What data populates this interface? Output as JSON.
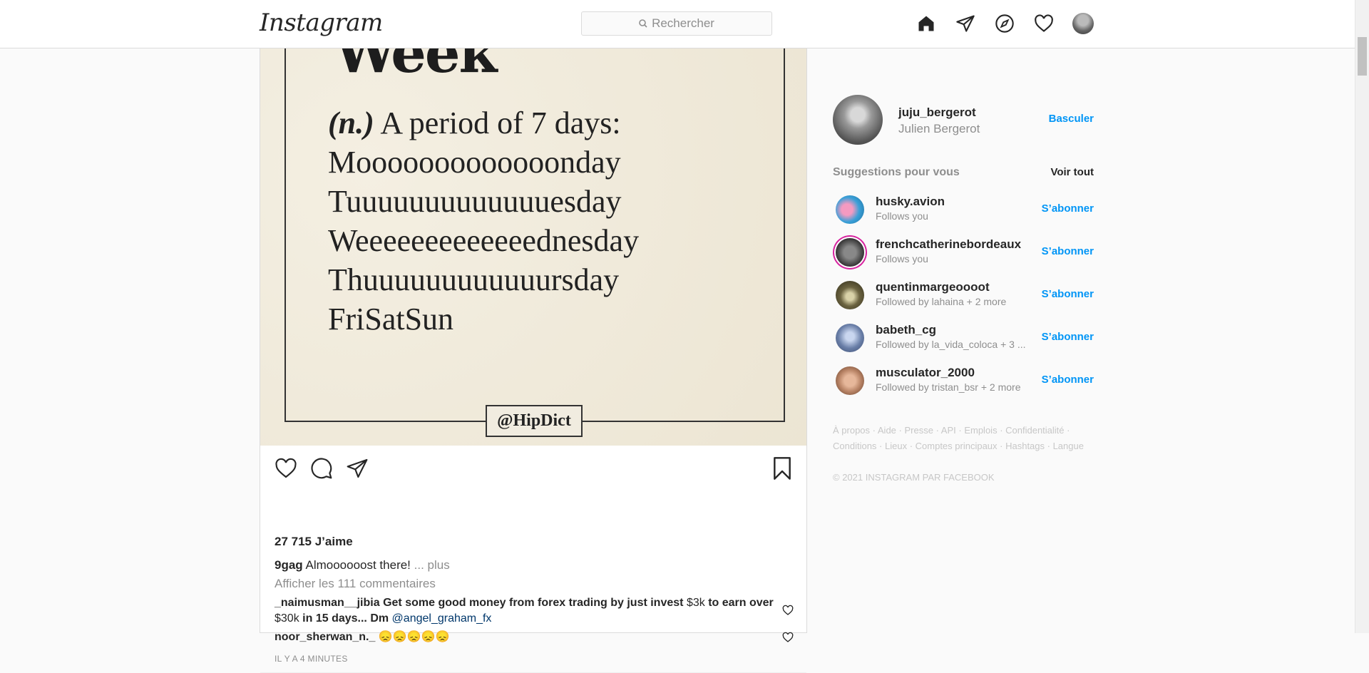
{
  "header": {
    "logo": "Instagram",
    "search_placeholder": "Rechercher"
  },
  "post": {
    "image": {
      "word": "Week",
      "pos": "(n.)",
      "definition_first": "A period of 7 days:",
      "lines": [
        "Mooooooooooooonday",
        "Tuuuuuuuuuuuuuesday",
        "Weeeeeeeeeeeeednesday",
        "Thuuuuuuuuuuuursday",
        "FriSatSun"
      ],
      "handle": "@HipDict"
    },
    "likes": "27 715 J’aime",
    "caption": {
      "user": "9gag",
      "text": "Almoooooost there!",
      "more": "... plus"
    },
    "view_comments": "Afficher les 111 commentaires",
    "comments": [
      {
        "user": "_naimusman__jibia",
        "t1": "Get some good money from forex trading by just invest",
        "t2": "$3k",
        "t3": "to earn over",
        "t4": "$30k",
        "t5": "in 15 days... Dm",
        "mention": "@angel_graham_fx"
      },
      {
        "user": "noor_sherwan_n._",
        "text": "😞😞😞😞😞"
      }
    ],
    "timestamp": "IL Y A 4 MINUTES"
  },
  "sidebar": {
    "profile": {
      "username": "juju_bergerot",
      "fullname": "Julien Bergerot",
      "switch_label": "Basculer"
    },
    "suggestions_title": "Suggestions pour vous",
    "see_all": "Voir tout",
    "follow_label": "S’abonner",
    "suggestions": [
      {
        "name": "husky.avion",
        "sub": "Follows you",
        "color": "#3aa0d8"
      },
      {
        "name": "frenchcatherinebordeaux",
        "sub": "Follows you",
        "color": "#555555"
      },
      {
        "name": "quentinmargeoooot",
        "sub": "Followed by lahaina + 2 more",
        "color": "#6b6340"
      },
      {
        "name": "babeth_cg",
        "sub": "Followed by la_vida_coloca + 3 ...",
        "color": "#6a7fa8"
      },
      {
        "name": "musculator_2000",
        "sub": "Followed by tristan_bsr + 2 more",
        "color": "#b88365"
      }
    ],
    "footer_links": [
      "À propos",
      "Aide",
      "Presse",
      "API",
      "Emplois",
      "Confidentialité",
      "Conditions",
      "Lieux",
      "Comptes principaux",
      "Hashtags",
      "Langue"
    ],
    "copyright": "© 2021 INSTAGRAM PAR FACEBOOK"
  }
}
